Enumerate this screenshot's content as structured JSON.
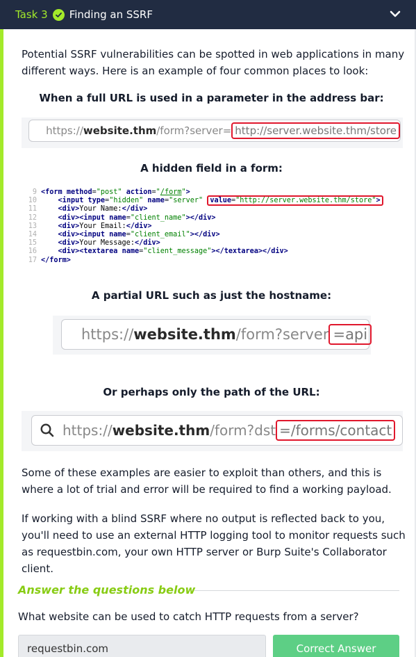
{
  "header": {
    "task_number": "Task 3",
    "title": "Finding an SSRF"
  },
  "intro": "Potential SSRF vulnerabilities can be spotted in web applications in many different ways. Here is an example of four common places to look:",
  "example1": {
    "heading": "When a full URL is used in a parameter in the address bar:",
    "url_scheme": "https://",
    "url_host": "website.thm",
    "url_path": "/form?server=",
    "url_highlight": "http://server.website.thm/store"
  },
  "example2": {
    "heading": "A hidden field in a form:",
    "line_numbers": [
      "9",
      "10",
      "11",
      "12",
      "13",
      "14",
      "15",
      "16",
      "17"
    ]
  },
  "example3": {
    "heading": "A partial URL such as just the hostname:",
    "url_scheme": "https://",
    "url_host": "website.thm",
    "url_path": "/form?server",
    "url_highlight": "=api"
  },
  "example4": {
    "heading": "Or perhaps only the path of the URL:",
    "url_scheme": "https://",
    "url_host": "website.thm",
    "url_path": "/form?dst",
    "url_highlight": "=/forms/contact"
  },
  "para2": "Some of these examples are easier to exploit than others, and this is where a lot of trial and error will be required to find a working payload.",
  "para3": "If working with a blind SSRF where no output is reflected back to you, you'll need to use an external HTTP logging tool to monitor requests such as requestbin.com, your own HTTP server or Burp Suite's Collaborator client.",
  "answers": {
    "title": "Answer the questions below",
    "question": "What website can be used to catch HTTP requests from a server?",
    "answer_value": "requestbin.com",
    "button_label": "Correct Answer"
  },
  "colors": {
    "accent": "#a3ea2a",
    "header_bg": "#212c42",
    "correct": "#5dcf85",
    "highlight_border": "#e0172c"
  }
}
